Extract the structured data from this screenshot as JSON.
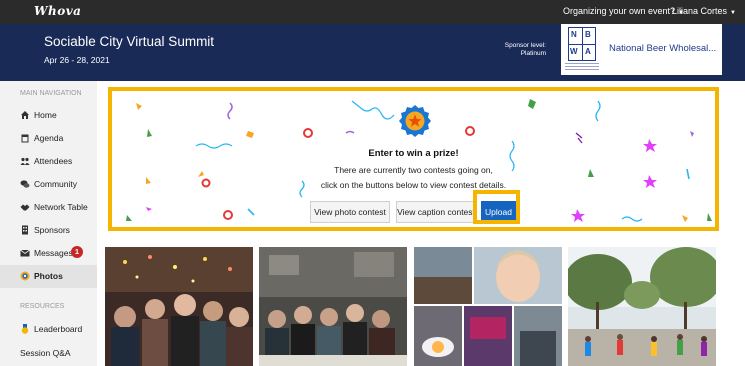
{
  "topbar": {
    "logo": "Whova",
    "organize_link": "Organizing your own event?",
    "user_name": "Liliana Cortes"
  },
  "event": {
    "title": "Sociable City Virtual Summit",
    "dates": "Apr 26 - 28, 2021"
  },
  "sponsor": {
    "level_label": "Sponsor level:",
    "level_value": "Platinum",
    "logo_letters": [
      "N",
      "B",
      "W",
      "A"
    ],
    "name": "National Beer Wholesal..."
  },
  "sidebar": {
    "main_heading": "MAIN NAVIGATION",
    "items": [
      {
        "label": "Home",
        "icon": "home-icon"
      },
      {
        "label": "Agenda",
        "icon": "calendar-icon"
      },
      {
        "label": "Attendees",
        "icon": "users-icon"
      },
      {
        "label": "Community",
        "icon": "chat-icon"
      },
      {
        "label": "Network Table",
        "icon": "handshake-icon"
      },
      {
        "label": "Sponsors",
        "icon": "building-icon"
      },
      {
        "label": "Messages",
        "icon": "envelope-icon",
        "badge": "1"
      },
      {
        "label": "Photos",
        "icon": "camera-icon",
        "active": true
      }
    ],
    "resources_heading": "RESOURCES",
    "resources": [
      {
        "label": "Leaderboard",
        "icon": "medal-icon"
      },
      {
        "label": "Session Q&A",
        "icon": ""
      }
    ]
  },
  "contest": {
    "title": "Enter to win a prize!",
    "line1": "There are currently two contests going on,",
    "line2": "click on the buttons below to view contest details.",
    "photo_button": "View photo contest",
    "caption_button": "View caption contest",
    "upload_button": "Upload"
  },
  "colors": {
    "topbar": "#2b2b2b",
    "banner": "#1a2a57",
    "highlight": "#f5b400",
    "upload": "#1565c0",
    "badge": "#c62828"
  }
}
